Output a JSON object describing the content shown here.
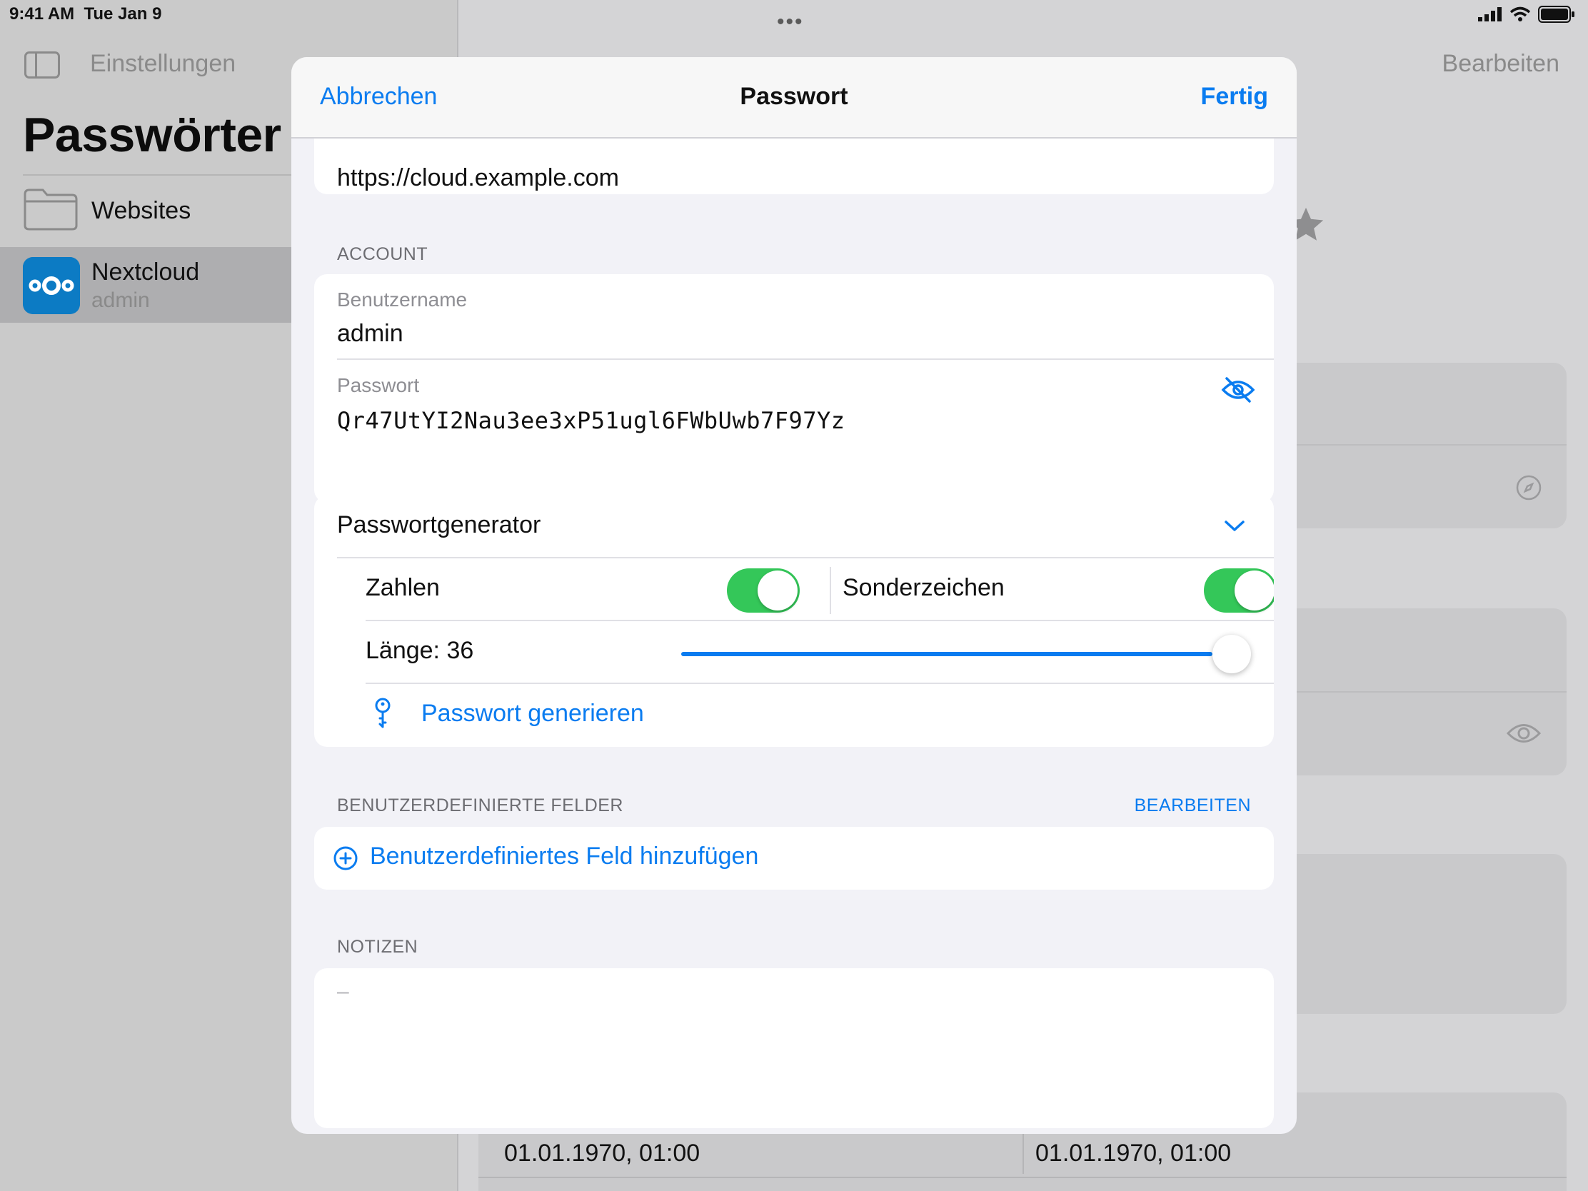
{
  "status_bar": {
    "time": "9:41 AM",
    "date": "Tue Jan 9"
  },
  "sidebar": {
    "back_label": "Einstellungen",
    "title": "Passwörter",
    "folder_label": "Websites",
    "entry": {
      "title": "Nextcloud",
      "subtitle": "admin"
    }
  },
  "detail": {
    "edit_label": "Bearbeiten",
    "date_created": "01.01.1970, 01:00",
    "date_updated": "01.01.1970, 01:00"
  },
  "modal": {
    "cancel_label": "Abbrechen",
    "title": "Passwort",
    "done_label": "Fertig",
    "url_value": "https://cloud.example.com",
    "account_header": "ACCOUNT",
    "username_label": "Benutzername",
    "username_value": "admin",
    "password_label": "Passwort",
    "password_value": "Qr47UtYI2Nau3ee3xP51ugl6FWbUwb7F97Yz",
    "generator": {
      "title": "Passwortgenerator",
      "numbers_label": "Zahlen",
      "numbers_on": true,
      "special_label": "Sonderzeichen",
      "special_on": true,
      "length_label": "Länge: 36",
      "length_fraction": 1.0,
      "generate_label": "Passwort generieren"
    },
    "custom_fields": {
      "header": "BENUTZERDEFINIERTE FELDER",
      "edit_label": "BEARBEITEN",
      "add_label": "Benutzerdefiniertes Feld hinzufügen"
    },
    "notes": {
      "header": "NOTIZEN",
      "placeholder": "–"
    }
  }
}
